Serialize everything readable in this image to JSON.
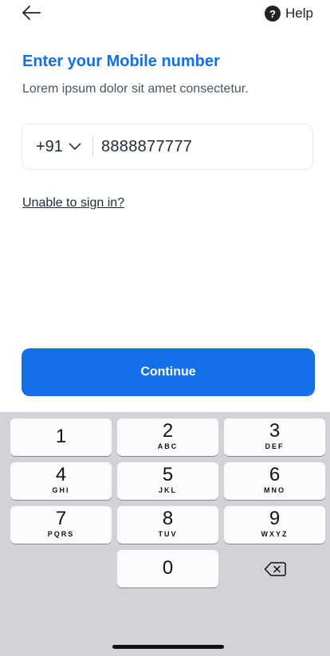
{
  "header": {
    "back_icon": "arrow-left-icon",
    "help_icon": "question-circle-icon",
    "help_label": "Help"
  },
  "main": {
    "title": "Enter your Mobile number",
    "subtitle": "Lorem ipsum dolor sit amet consectetur.",
    "country_code": "+91",
    "country_chevron_icon": "chevron-down-icon",
    "phone_number": "8888877777",
    "unable_link": "Unable to sign in?",
    "continue_label": "Continue"
  },
  "colors": {
    "accent": "#1470e8",
    "keyboard_bg": "#d1d3d9"
  },
  "keyboard": {
    "k1": {
      "num": "1",
      "letters": ""
    },
    "k2": {
      "num": "2",
      "letters": "ABC"
    },
    "k3": {
      "num": "3",
      "letters": "DEF"
    },
    "k4": {
      "num": "4",
      "letters": "GHI"
    },
    "k5": {
      "num": "5",
      "letters": "JKL"
    },
    "k6": {
      "num": "6",
      "letters": "MNO"
    },
    "k7": {
      "num": "7",
      "letters": "PQRS"
    },
    "k8": {
      "num": "8",
      "letters": "TUV"
    },
    "k9": {
      "num": "9",
      "letters": "WXYZ"
    },
    "k0": {
      "num": "0",
      "letters": ""
    },
    "backspace_icon": "backspace-icon"
  }
}
